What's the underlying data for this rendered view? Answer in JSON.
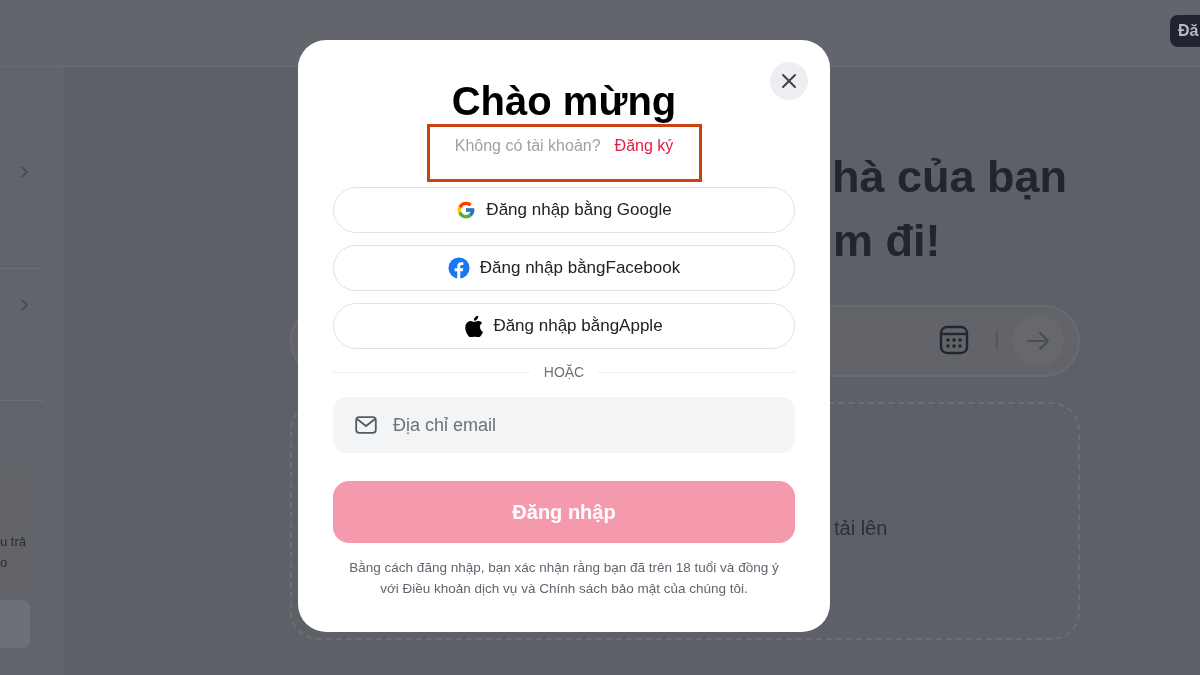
{
  "background": {
    "header_button": "Đă",
    "heading_line_1_right": "hà của bạn",
    "heading_line_2_right": "m đi!",
    "upload_text": "tải lên",
    "sidebar_card_lines": [
      "u trả",
      "o"
    ]
  },
  "modal": {
    "title": "Chào mừng",
    "signup_prompt": "Không có tài khoản?",
    "signup_link": "Đăng ký",
    "providers": [
      {
        "kind": "google",
        "label": "Đăng nhập bằng Google"
      },
      {
        "kind": "facebook",
        "label": "Đăng nhập bằngFacebook"
      },
      {
        "kind": "apple",
        "label": "Đăng nhập bằngApple"
      }
    ],
    "divider": "HOẶC",
    "email": {
      "placeholder": "Địa chỉ email"
    },
    "submit": {
      "label": "Đăng nhập",
      "disabled": true
    },
    "legal": "Bằng cách đăng nhập, bạn xác nhận rằng bạn đã trên 18 tuổi và đồng ý với Điều khoản dịch vụ và Chính sách bảo mật của chúng tôi."
  }
}
